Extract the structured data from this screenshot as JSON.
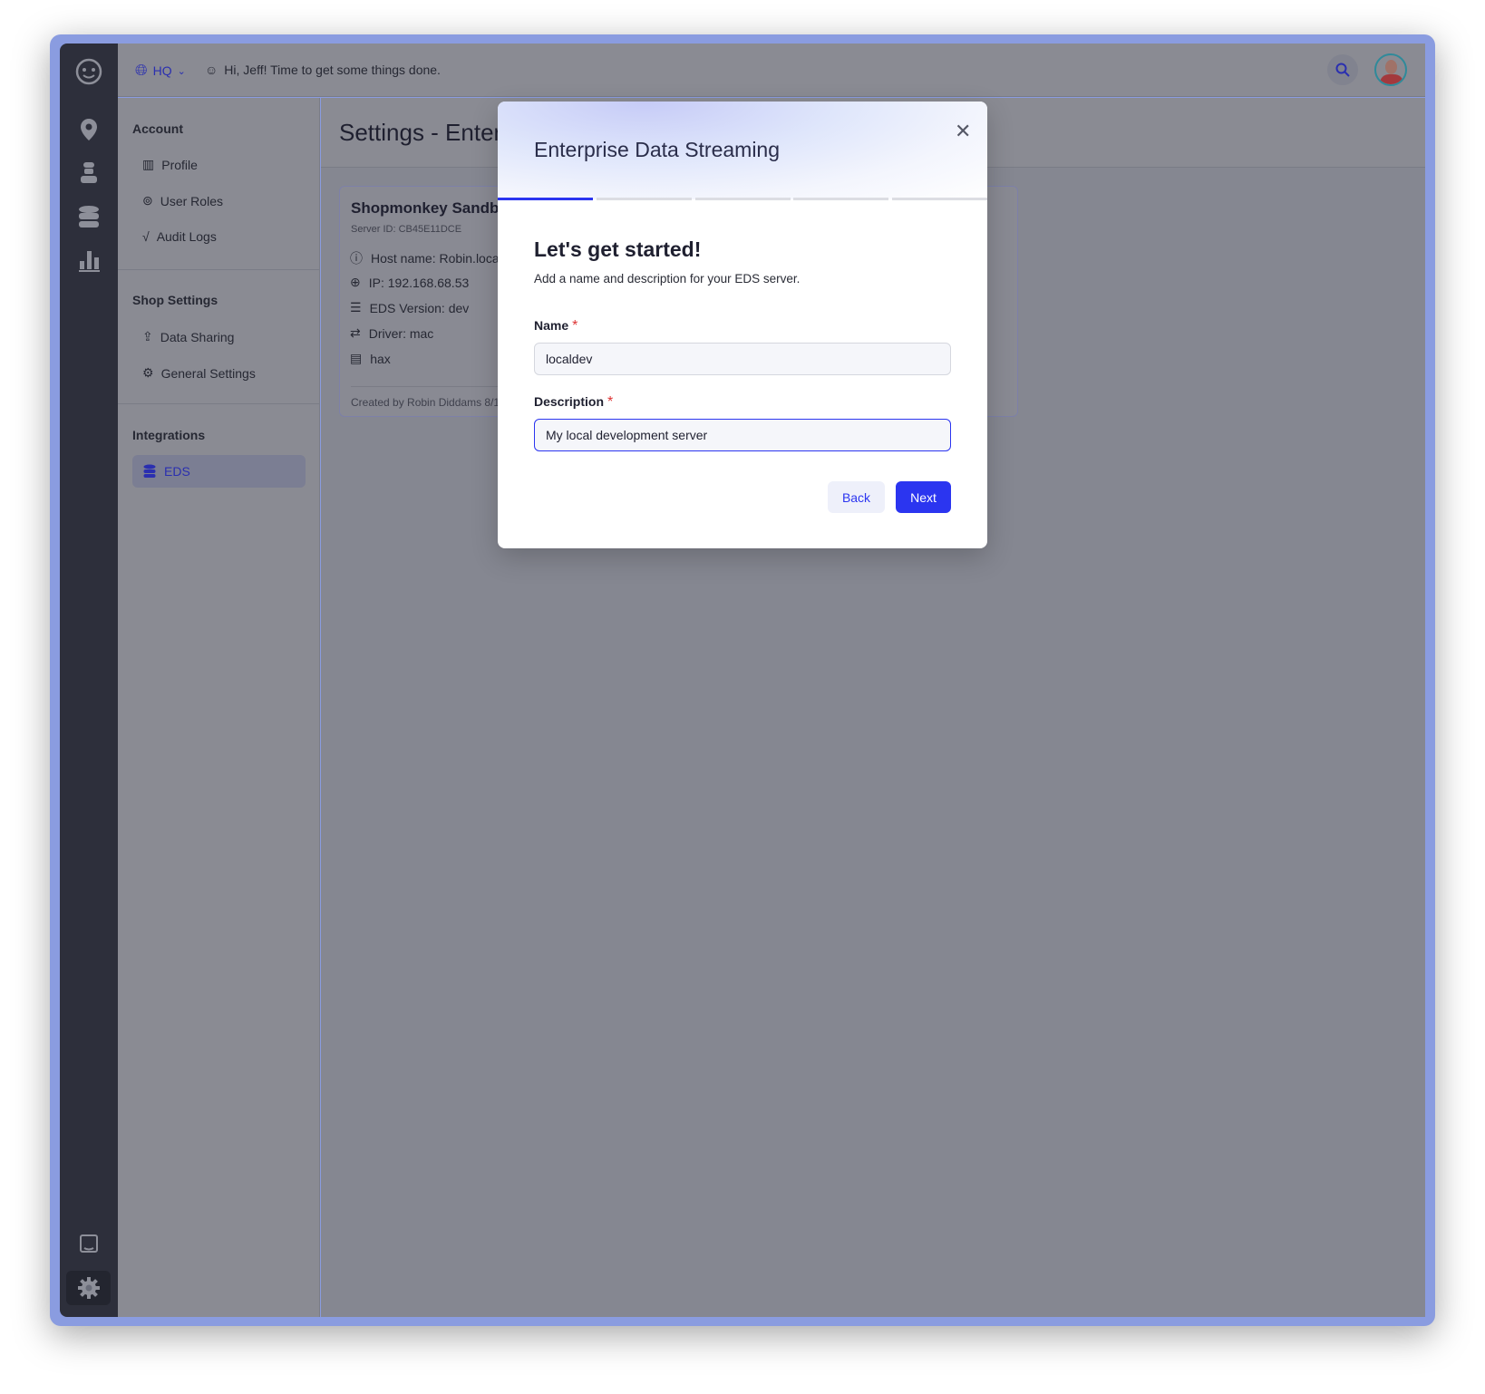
{
  "topbar": {
    "location": "HQ",
    "greeting": "Hi, Jeff! Time to get some things done."
  },
  "rail": {
    "items": [
      "map-pin",
      "technician",
      "database",
      "bar-chart"
    ],
    "bottom": [
      "book",
      "settings"
    ]
  },
  "nav": {
    "sections": [
      {
        "title": "Account",
        "items": [
          "Profile",
          "User Roles",
          "Audit Logs"
        ]
      },
      {
        "title": "Shop Settings",
        "items": [
          "Data Sharing",
          "General Settings"
        ]
      },
      {
        "title": "Integrations",
        "items": [
          "EDS"
        ]
      }
    ],
    "active": "EDS"
  },
  "page": {
    "title": "Settings - Enter"
  },
  "card": {
    "title": "Shopmonkey Sandb",
    "server_id": "Server ID: CB45E11DCE",
    "rows": [
      "Host name: Robin.loca",
      "IP: 192.168.68.53",
      "EDS Version: dev",
      "Driver: mac",
      "hax"
    ],
    "footer": "Created by Robin Diddams 8/1"
  },
  "modal": {
    "title": "Enterprise Data Streaming",
    "step": 1,
    "steps": 5,
    "heading": "Let's get started!",
    "subtitle": "Add a name and description for your EDS server.",
    "name_label": "Name",
    "name_value": "localdev",
    "desc_label": "Description",
    "desc_value": "My local development server",
    "required": "*",
    "back": "Back",
    "next": "Next"
  },
  "colors": {
    "accent": "#2b35f0",
    "frame": "#8a9ce0",
    "rail": "#2d2f3b"
  }
}
